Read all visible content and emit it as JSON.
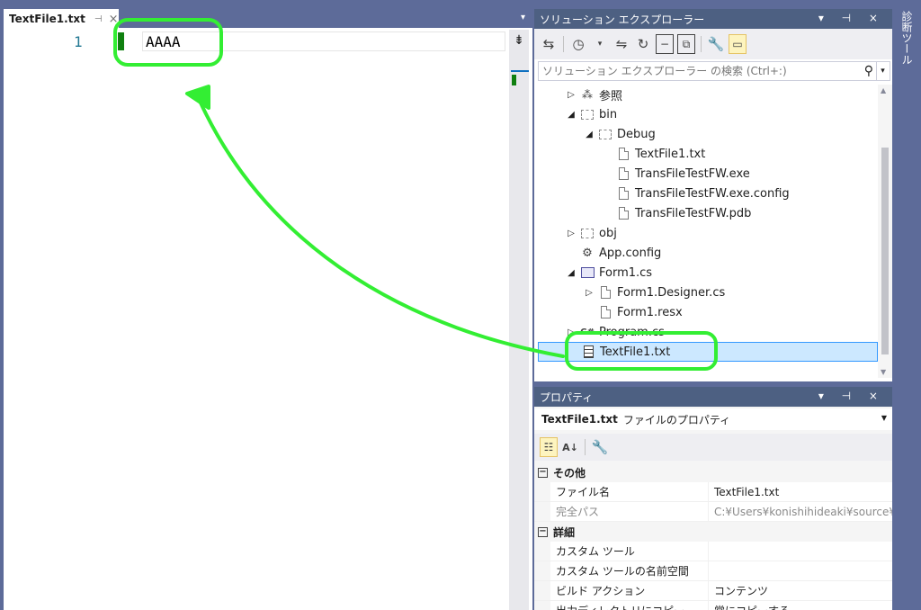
{
  "editor": {
    "tab_title": "TextFile1.txt",
    "pin_glyph": "⊣",
    "close_glyph": "×",
    "overflow_glyph": "▾",
    "line_number": "1",
    "code": "AAAA",
    "split_glyph": "⇟"
  },
  "solution_explorer": {
    "title": "ソリューション エクスプローラー",
    "title_controls": "▾ ⊣ ×",
    "search_placeholder": "ソリューション エクスプローラー の検索 (Ctrl+:)",
    "toolbar_icons": [
      "switch-views-icon",
      "history-icon",
      "dropdown-icon",
      "sync-icon",
      "refresh-icon",
      "collapse-all-icon",
      "show-all-files-icon",
      "properties-icon",
      "preview-icon"
    ],
    "tree": [
      {
        "label": "参照",
        "expander": "▷",
        "icon": "references-icon"
      },
      {
        "label": "bin",
        "expander": "◢",
        "icon": "folder-icon"
      },
      {
        "label": "Debug",
        "expander": "◢",
        "icon": "folder-icon"
      },
      {
        "label": "TextFile1.txt",
        "expander": "",
        "icon": "file-icon"
      },
      {
        "label": "TransFileTestFW.exe",
        "expander": "",
        "icon": "file-icon"
      },
      {
        "label": "TransFileTestFW.exe.config",
        "expander": "",
        "icon": "file-icon"
      },
      {
        "label": "TransFileTestFW.pdb",
        "expander": "",
        "icon": "file-icon"
      },
      {
        "label": "obj",
        "expander": "▷",
        "icon": "folder-icon"
      },
      {
        "label": "App.config",
        "expander": "",
        "icon": "config-icon"
      },
      {
        "label": "Form1.cs",
        "expander": "◢",
        "icon": "form-icon"
      },
      {
        "label": "Form1.Designer.cs",
        "expander": "▷",
        "icon": "file-icon"
      },
      {
        "label": "Form1.resx",
        "expander": "",
        "icon": "file-icon"
      },
      {
        "label": "Program.cs",
        "expander": "▷",
        "icon": "csharp-icon"
      },
      {
        "label": "TextFile1.txt",
        "expander": "",
        "icon": "text-file-icon",
        "selected": true
      }
    ]
  },
  "properties": {
    "title": "プロパティ",
    "title_controls": "▾ ⊣ ×",
    "object_name": "TextFile1.txt",
    "object_type": "ファイルのプロパティ",
    "categories": [
      {
        "label": "その他",
        "rows": [
          {
            "name": "ファイル名",
            "value": "TextFile1.txt",
            "dim": false
          },
          {
            "name": "完全パス",
            "value": "C:¥Users¥konishihideaki¥source¥",
            "dim": true
          }
        ]
      },
      {
        "label": "詳細",
        "rows": [
          {
            "name": "カスタム ツール",
            "value": "",
            "dim": false
          },
          {
            "name": "カスタム ツールの名前空間",
            "value": "",
            "dim": false
          },
          {
            "name": "ビルド アクション",
            "value": "コンテンツ",
            "dim": false
          },
          {
            "name": "出力ディレクトリにコピー",
            "value": "常にコピーする",
            "dim": false
          }
        ]
      }
    ]
  },
  "side_strip": {
    "tab_label": "診断ツール"
  },
  "colors": {
    "frame": "#5d6b99",
    "title_bar": "#4d6082",
    "annotation": "#33ee33",
    "selection": "#cce8ff"
  }
}
